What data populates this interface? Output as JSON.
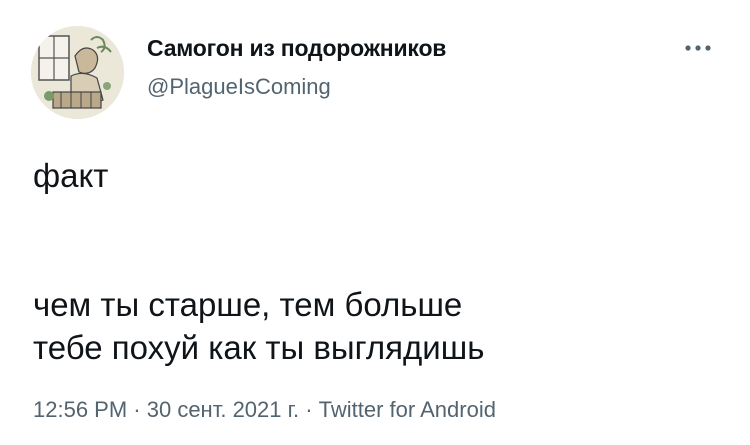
{
  "tweet": {
    "author": {
      "display_name": "Самогон из подорожников",
      "handle": "@PlagueIsComing",
      "avatar_icon": "profile-avatar-illustration"
    },
    "more_icon": "more-options-icon",
    "text": "факт\n\n\nчем ты старше, тем больше\nтебе похуй как ты выглядишь",
    "time": "12:56 PM",
    "separator": " · ",
    "date": "30 сент. 2021 г.",
    "source": "Twitter for Android"
  },
  "colors": {
    "text_primary": "#0f1419",
    "text_secondary": "#536471",
    "background": "#ffffff"
  }
}
